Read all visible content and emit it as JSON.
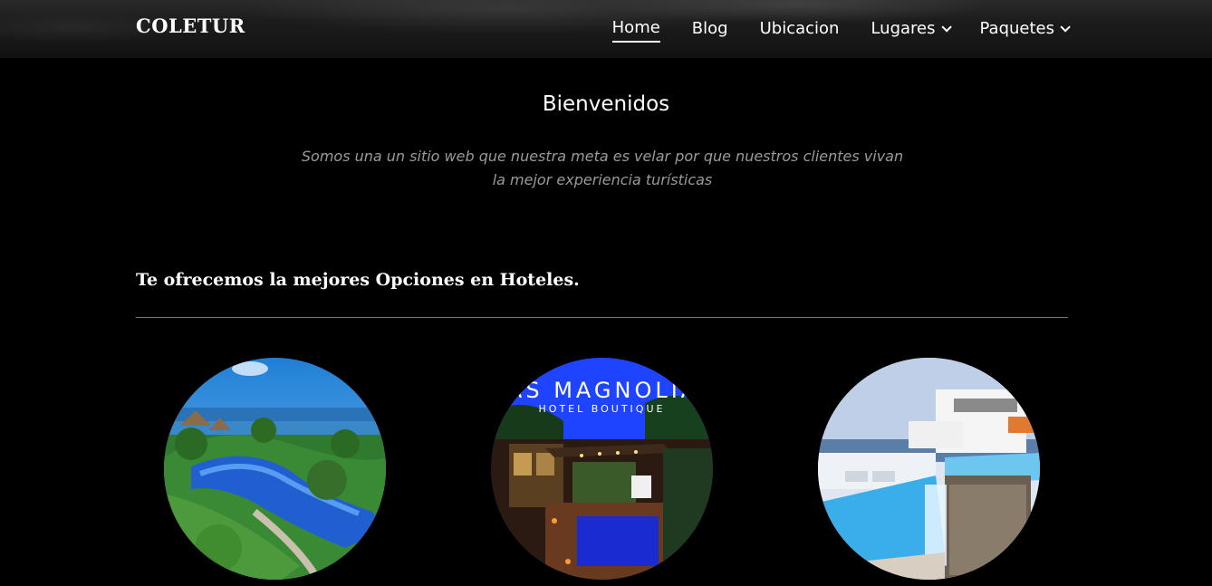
{
  "nav": {
    "brand": "COLETUR",
    "links": [
      {
        "label": "Home",
        "active": true,
        "dropdown": false
      },
      {
        "label": "Blog",
        "active": false,
        "dropdown": false
      },
      {
        "label": "Ubicacion",
        "active": false,
        "dropdown": false
      },
      {
        "label": "Lugares",
        "active": false,
        "dropdown": true
      },
      {
        "label": "Paquetes",
        "active": false,
        "dropdown": true
      }
    ]
  },
  "welcome": {
    "title": "Bienvenidos",
    "text": "Somos una un sitio web que nuestra meta es velar por que nuestros  clientes vivan la mejor experiencia turísticas"
  },
  "hotels": {
    "title": "Te ofrecemos la mejores Opciones en Hoteles.",
    "items": [
      {
        "image": "resort-pool-beach-photo"
      },
      {
        "image": "hotel-boutique-courtyard-photo",
        "logo_text": "LAS MAGNOLIAS",
        "logo_sub": "HOTEL BOUTIQUE"
      },
      {
        "image": "oceanfront-infinity-pool-photo"
      }
    ]
  }
}
